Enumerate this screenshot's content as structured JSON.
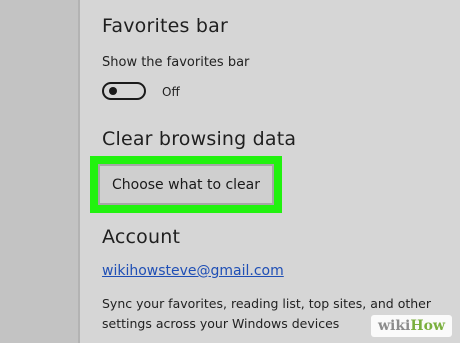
{
  "favorites_bar": {
    "title": "Favorites bar",
    "show_label": "Show the favorites bar",
    "toggle_state": "Off",
    "toggle_on": false
  },
  "clear_browsing": {
    "title": "Clear browsing data",
    "button_label": "Choose what to clear",
    "highlight_color": "#21f20f"
  },
  "account": {
    "title": "Account",
    "email": "wikihowsteve@gmail.com",
    "description": "Sync your favorites, reading list, top sites, and other settings across your Windows devices"
  },
  "watermark": {
    "wiki": "wiki",
    "how": "How"
  },
  "colors": {
    "panel_background": "#d6d6d6",
    "link": "#1f4fb5",
    "watermark_green": "#7aaf3e"
  }
}
